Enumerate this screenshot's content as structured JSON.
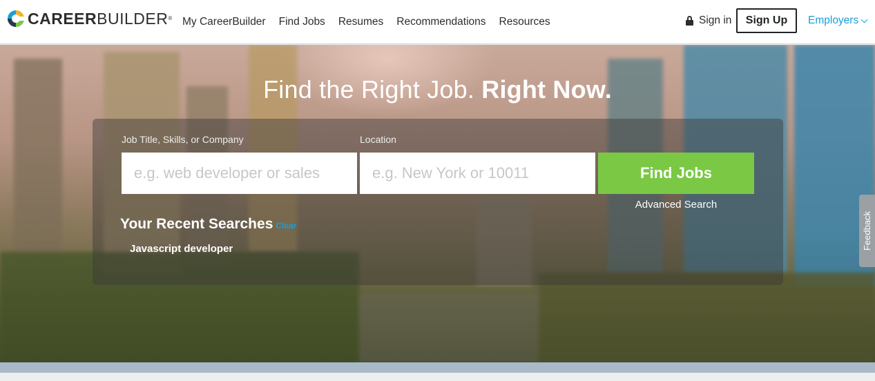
{
  "brand": {
    "logo_bold": "CAREER",
    "logo_light": "BUILDER",
    "logo_mark": "®"
  },
  "nav": {
    "items": [
      {
        "label": "My CareerBuilder"
      },
      {
        "label": "Find Jobs"
      },
      {
        "label": "Resumes"
      },
      {
        "label": "Recommendations"
      },
      {
        "label": "Resources"
      }
    ],
    "signin_label": "Sign in",
    "signup_label": "Sign Up",
    "employers_label": "Employers",
    "lock_icon": "lock-icon"
  },
  "hero": {
    "headline_light": "Find the Right Job.",
    "headline_bold": "Right Now."
  },
  "search": {
    "title_label": "Job Title, Skills, or Company",
    "title_placeholder": "e.g. web developer or sales",
    "location_label": "Location",
    "location_placeholder": "e.g. New York or 10011",
    "find_button": "Find Jobs",
    "advanced_link": "Advanced Search"
  },
  "recent": {
    "title": "Your Recent Searches",
    "clear_label": "Clear",
    "items": [
      "Javascript developer"
    ]
  },
  "feedback_label": "Feedback",
  "colors": {
    "accent_blue": "#1a9fd9",
    "find_green": "#7bc845",
    "text_dark": "#2b2d2f"
  }
}
